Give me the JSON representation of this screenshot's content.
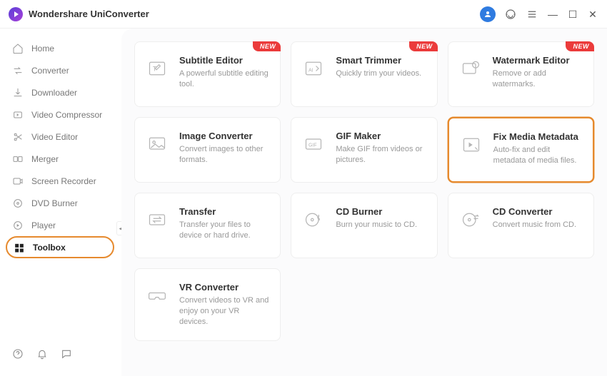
{
  "app": {
    "title": "Wondershare UniConverter"
  },
  "badge": {
    "new": "NEW"
  },
  "sidebar": {
    "items": [
      {
        "label": "Home"
      },
      {
        "label": "Converter"
      },
      {
        "label": "Downloader"
      },
      {
        "label": "Video Compressor"
      },
      {
        "label": "Video Editor"
      },
      {
        "label": "Merger"
      },
      {
        "label": "Screen Recorder"
      },
      {
        "label": "DVD Burner"
      },
      {
        "label": "Player"
      },
      {
        "label": "Toolbox"
      }
    ]
  },
  "tools": [
    {
      "title": "Subtitle Editor",
      "desc": "A powerful subtitle editing tool.",
      "new": true
    },
    {
      "title": "Smart Trimmer",
      "desc": "Quickly trim your videos.",
      "new": true
    },
    {
      "title": "Watermark Editor",
      "desc": "Remove or add watermarks.",
      "new": true
    },
    {
      "title": "Image Converter",
      "desc": "Convert images to other formats.",
      "new": false
    },
    {
      "title": "GIF Maker",
      "desc": "Make GIF from videos or pictures.",
      "new": false
    },
    {
      "title": "Fix Media Metadata",
      "desc": "Auto-fix and edit metadata of media files.",
      "new": false
    },
    {
      "title": "Transfer",
      "desc": "Transfer your files to device or hard drive.",
      "new": false
    },
    {
      "title": "CD Burner",
      "desc": "Burn your music to CD.",
      "new": false
    },
    {
      "title": "CD Converter",
      "desc": "Convert music from CD.",
      "new": false
    },
    {
      "title": "VR Converter",
      "desc": "Convert videos to VR and enjoy on your VR devices.",
      "new": false
    }
  ]
}
